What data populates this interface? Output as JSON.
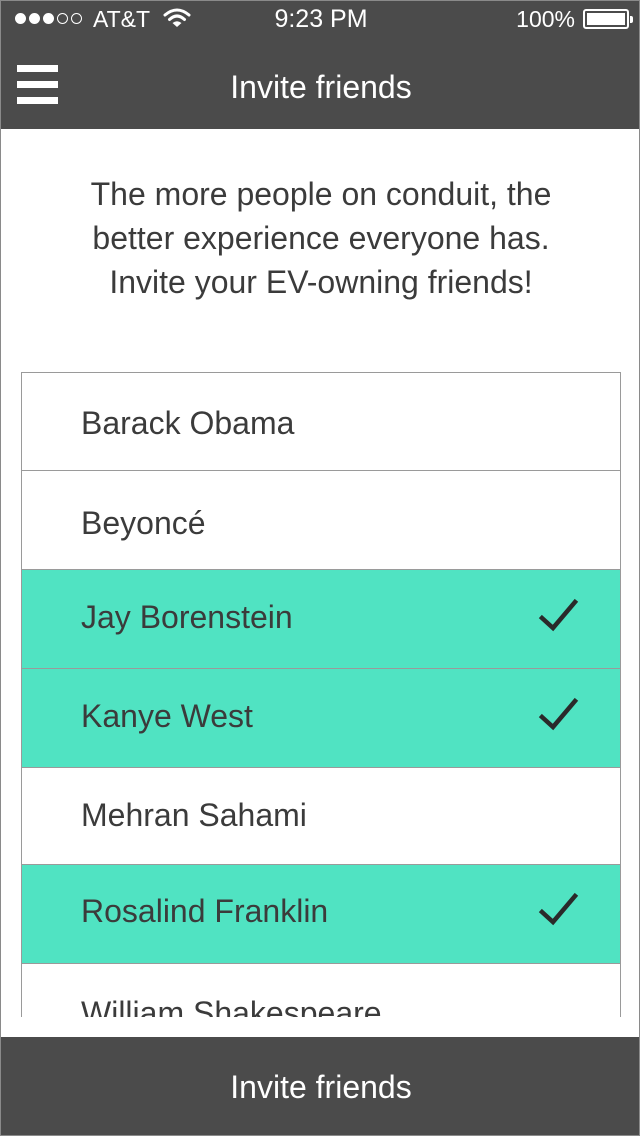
{
  "status_bar": {
    "carrier": "AT&T",
    "time": "9:23 PM",
    "battery_percent": "100%",
    "signal_bars_filled": 3,
    "signal_bars_total": 5,
    "battery_level": 1.0
  },
  "header": {
    "menu_icon": "hamburger-menu-icon",
    "title": "Invite friends"
  },
  "intro": {
    "line1": "The more people on conduit, the",
    "line2": "better experience everyone has.",
    "line3": "Invite your EV-owning friends!"
  },
  "friends": [
    {
      "name": "Barack Obama",
      "selected": false
    },
    {
      "name": "Beyoncé",
      "selected": false
    },
    {
      "name": "Jay Borenstein",
      "selected": true
    },
    {
      "name": "Kanye West",
      "selected": true
    },
    {
      "name": "Mehran Sahami",
      "selected": false
    },
    {
      "name": "Rosalind Franklin",
      "selected": true
    },
    {
      "name": "William Shakespeare",
      "selected": false
    }
  ],
  "footer": {
    "invite_label": "Invite friends"
  },
  "colors": {
    "bar_background": "#4b4b4b",
    "selected_row": "#50e3c2",
    "text": "#3b3b3b",
    "divider": "#9a9a9a"
  },
  "icons": {
    "check": "checkmark-icon",
    "wifi": "wifi-icon",
    "battery": "battery-icon"
  }
}
